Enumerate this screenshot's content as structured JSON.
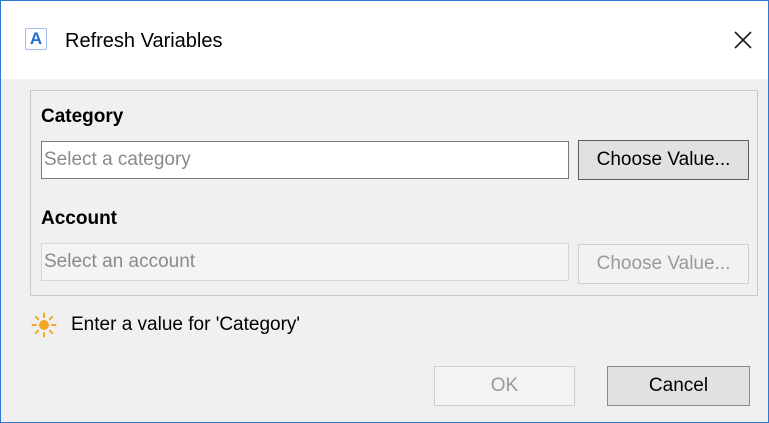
{
  "window": {
    "title": "Refresh Variables",
    "app_icon_letter": "A",
    "close_icon": "close-icon"
  },
  "fields": {
    "category": {
      "label": "Category",
      "value": "",
      "placeholder": "Select a category",
      "button_label": "Choose Value...",
      "enabled": true
    },
    "account": {
      "label": "Account",
      "value": "",
      "placeholder": "Select an account",
      "button_label": "Choose Value...",
      "enabled": false
    }
  },
  "hint": {
    "icon": "sun-icon",
    "text": "Enter a value for 'Category'"
  },
  "footer": {
    "ok_label": "OK",
    "ok_enabled": false,
    "cancel_label": "Cancel"
  },
  "colors": {
    "accent_border": "#2b79d6",
    "hint_icon": "#f5a623"
  }
}
